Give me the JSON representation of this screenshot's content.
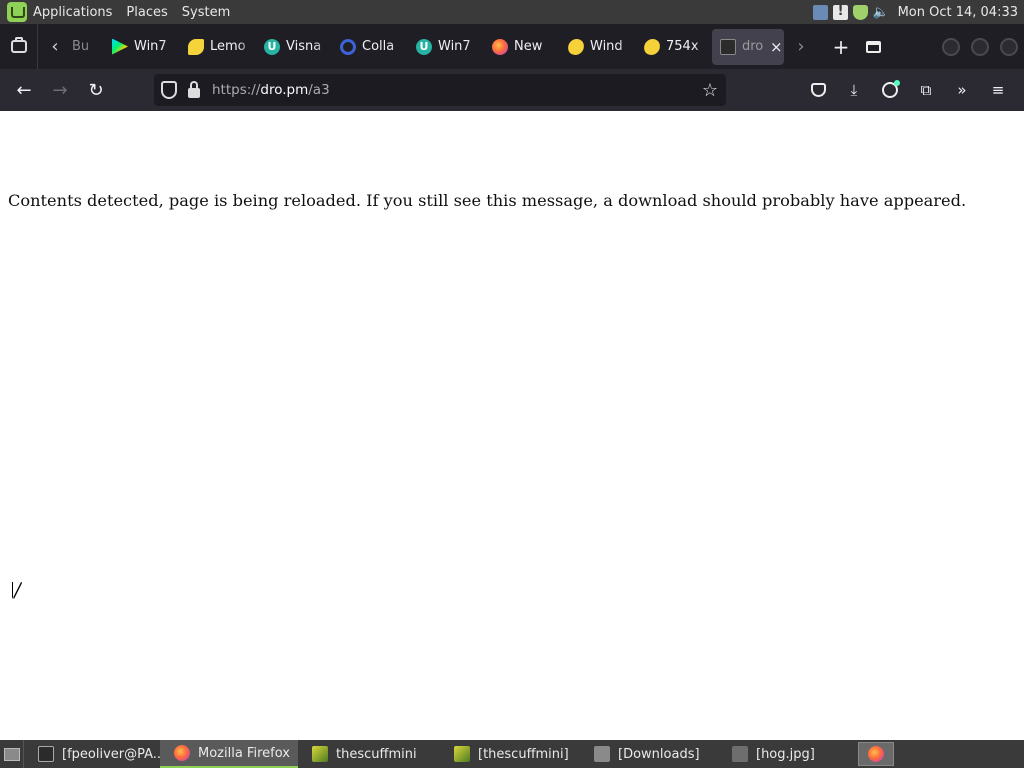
{
  "system_panel": {
    "menus": [
      "Applications",
      "Places",
      "System"
    ],
    "clock": "Mon Oct 14, 04:33",
    "tray_icons": [
      "network-icon",
      "update-icon",
      "shield-icon",
      "volume-icon"
    ]
  },
  "browser": {
    "tabs": [
      {
        "label": "Bu",
        "icon": "page-icon"
      },
      {
        "label": "Win7",
        "icon": "google-play-icon"
      },
      {
        "label": "Lemo",
        "icon": "lemon-icon"
      },
      {
        "label": "Visna",
        "icon": "u-logo-icon"
      },
      {
        "label": "Colla",
        "icon": "search-icon"
      },
      {
        "label": "Win7",
        "icon": "u-logo-icon"
      },
      {
        "label": "New",
        "icon": "firefox-icon"
      },
      {
        "label": "Wind",
        "icon": "wind-icon"
      },
      {
        "label": "754x",
        "icon": "wind-icon"
      }
    ],
    "active_tab": {
      "label": "dro",
      "icon": "terminal-icon",
      "close": "×"
    },
    "url": {
      "scheme": "https://",
      "host": "dro.pm",
      "path": "/a3"
    },
    "icons": {
      "back": "←",
      "forward": "→",
      "reload": "↻",
      "star": "☆",
      "download": "⤓",
      "extensions": "⧉",
      "overflow": "»",
      "menu": "≡",
      "scroll_left": "‹",
      "scroll_right": "›",
      "new_tab": "+"
    }
  },
  "page": {
    "message": "Contents detected, page is being reloaded. If you still see this message, a download should probably have appeared."
  },
  "taskbar": {
    "tasks": [
      {
        "label": "[fpeoliver@PA...",
        "icon": "terminal-icon",
        "active": false
      },
      {
        "label": "Mozilla Firefox",
        "icon": "firefox-icon",
        "active": true
      },
      {
        "label": "thescuffmini",
        "icon": "image-icon",
        "active": false
      },
      {
        "label": "[thescuffmini]",
        "icon": "image-icon",
        "active": false
      },
      {
        "label": "[Downloads]",
        "icon": "folder-icon",
        "active": false
      },
      {
        "label": "[hog.jpg]",
        "icon": "file-icon",
        "active": false
      }
    ]
  }
}
